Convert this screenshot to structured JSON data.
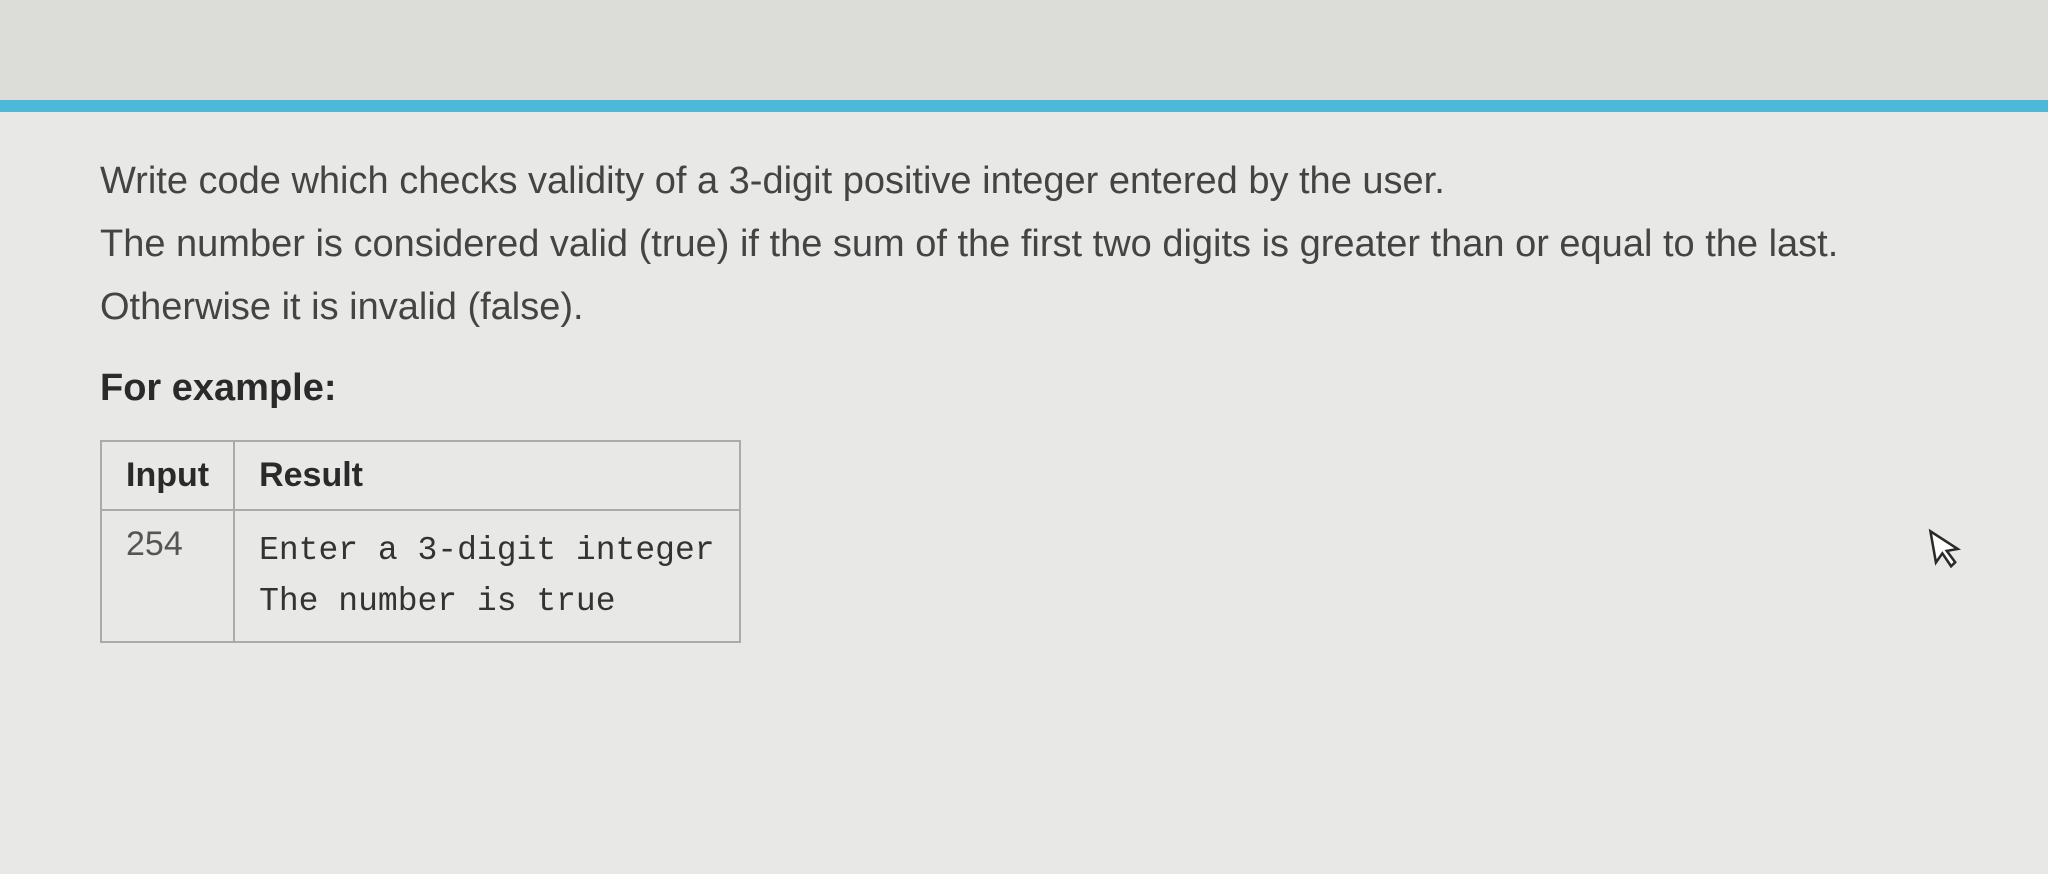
{
  "question": {
    "line1": "Write code which checks validity of a 3-digit positive integer entered by the user.",
    "line2": "The number is considered valid (true) if the sum of the first two digits is greater than or equal to the last.",
    "line3": "Otherwise it is invalid (false).",
    "example_label": "For example:",
    "table": {
      "headers": {
        "input": "Input",
        "result": "Result"
      },
      "row": {
        "input": "254",
        "result_l1": "Enter a 3-digit integer",
        "result_l2": "The number is true"
      }
    }
  }
}
